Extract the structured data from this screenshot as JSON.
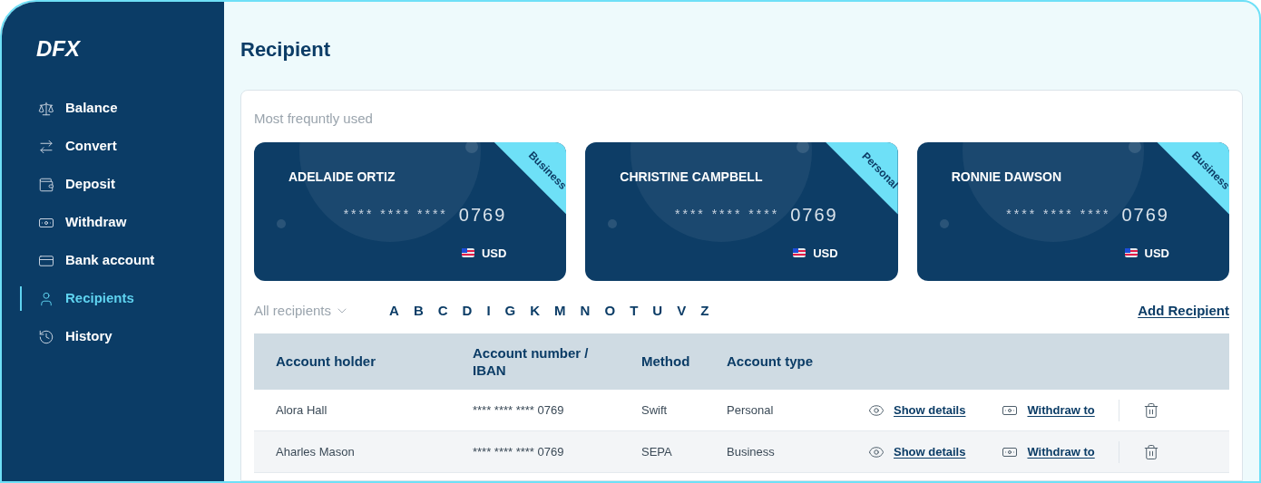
{
  "logo": "DFX",
  "sidebar": {
    "items": [
      {
        "label": "Balance",
        "selected": false
      },
      {
        "label": "Convert",
        "selected": false
      },
      {
        "label": "Deposit",
        "selected": false
      },
      {
        "label": "Withdraw",
        "selected": false
      },
      {
        "label": "Bank account",
        "selected": false
      },
      {
        "label": "Recipients",
        "selected": true
      },
      {
        "label": "History",
        "selected": false
      }
    ]
  },
  "title": "Recipient",
  "frequent": {
    "heading": "Most frequntly used",
    "cards": [
      {
        "name": "ADELAIDE ORTIZ",
        "mask": "**** **** ****",
        "last4": "0769",
        "currency": "USD",
        "type": "Business"
      },
      {
        "name": "CHRISTINE CAMPBELL",
        "mask": "**** **** ****",
        "last4": "0769",
        "currency": "USD",
        "type": "Personal"
      },
      {
        "name": "RONNIE DAWSON",
        "mask": "**** **** ****",
        "last4": "0769",
        "currency": "USD",
        "type": "Business"
      }
    ]
  },
  "filter": {
    "label": "All recipients",
    "letters": [
      "A",
      "B",
      "C",
      "D",
      "I",
      "G",
      "K",
      "M",
      "N",
      "O",
      "T",
      "U",
      "V",
      "Z"
    ],
    "add": "Add Recipient"
  },
  "table": {
    "columns": [
      "Account holder",
      "Account number / IBAN",
      "Method",
      "Account type"
    ],
    "rows": [
      {
        "holder": "Alora Hall",
        "number": "**** **** **** 0769",
        "method": "Swift",
        "type": "Personal",
        "details": "Show details",
        "withdraw": "Withdraw to",
        "shaded": false
      },
      {
        "holder": "Aharles Mason",
        "number": "**** **** **** 0769",
        "method": "SEPA",
        "type": "Business",
        "details": "Show details",
        "withdraw": "Withdraw to",
        "shaded": true
      }
    ]
  }
}
